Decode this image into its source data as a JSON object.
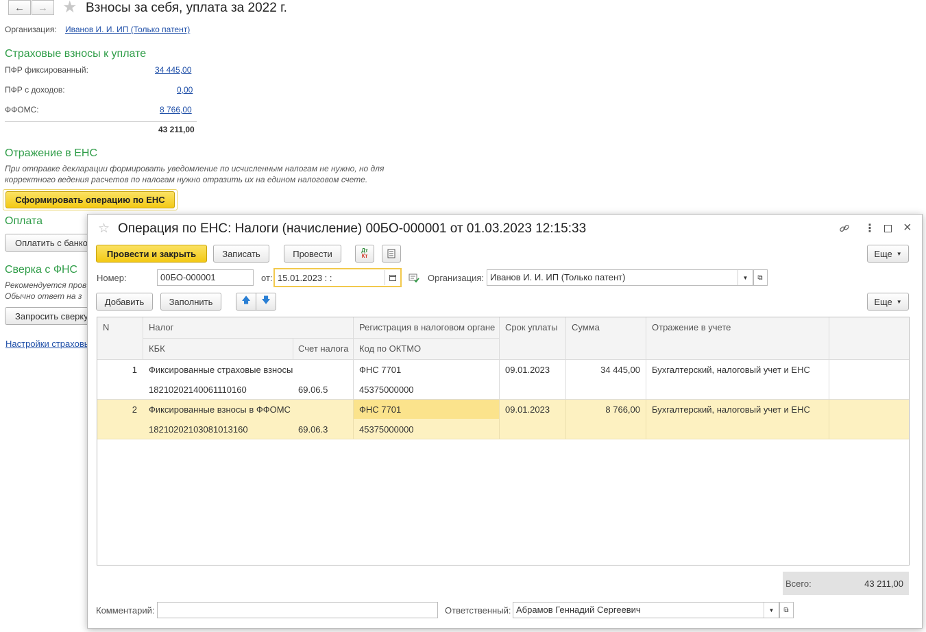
{
  "window": {
    "title": "Взносы за себя, уплата за 2022 г.",
    "org_label": "Организация:",
    "org_value": "Иванов И. И. ИП (Только патент)"
  },
  "contributions": {
    "heading": "Страховые взносы к уплате",
    "rows": [
      {
        "label": "ПФР фиксированный:",
        "value": "34 445,00"
      },
      {
        "label": "ПФР с доходов:",
        "value": "0,00"
      },
      {
        "label": "ФФОМС:",
        "value": "8 766,00"
      }
    ],
    "total": "43 211,00"
  },
  "ens": {
    "heading": "Отражение в ЕНС",
    "note_line1": "При отправке декларации формировать уведомление по исчисленным налогам не нужно, но для",
    "note_line2": "корректного ведения расчетов по налогам нужно отразить их на едином налоговом счете.",
    "button": "Сформировать операцию по ЕНС"
  },
  "payment": {
    "heading": "Оплата",
    "button": "Оплатить с банков"
  },
  "fns": {
    "heading": "Сверка с ФНС",
    "note_line1": "Рекомендуется пров",
    "note_line2": "Обычно ответ на з",
    "button": "Запросить сверку"
  },
  "settings_link": "Настройки страховы",
  "modal": {
    "title": "Операция по ЕНС: Налоги (начисление) 00БО-000001 от 01.03.2023 12:15:33",
    "buttons": {
      "post_close": "Провести и закрыть",
      "save": "Записать",
      "post": "Провести",
      "more": "Еще",
      "add": "Добавить",
      "fill": "Заполнить",
      "more2": "Еще"
    },
    "number_label": "Номер:",
    "number_value": "00БО-000001",
    "date_label": "от:",
    "date_value": "15.01.2023  :  :",
    "org_label": "Организация:",
    "org_value": "Иванов И. И. ИП (Только патент)",
    "table": {
      "headers": {
        "n": "N",
        "tax": "Налог",
        "kbk": "КБК",
        "account": "Счет налога",
        "registration": "Регистрация в налоговом органе",
        "oktmo": "Код по ОКТМО",
        "due": "Срок уплаты",
        "amount": "Сумма",
        "reflection": "Отражение в учете"
      },
      "rows": [
        {
          "n": "1",
          "tax": "Фиксированные страховые взносы",
          "kbk": "18210202140061110160",
          "account": "69.06.5",
          "registration": "ФНС 7701",
          "oktmo": "45375000000",
          "due": "09.01.2023",
          "amount": "34 445,00",
          "reflection": "Бухгалтерский, налоговый учет и ЕНС"
        },
        {
          "n": "2",
          "tax": "Фиксированные взносы в ФФОМС",
          "kbk": "18210202103081013160",
          "account": "69.06.3",
          "registration": "ФНС 7701",
          "oktmo": "45375000000",
          "due": "09.01.2023",
          "amount": "8 766,00",
          "reflection": "Бухгалтерский, налоговый учет и ЕНС"
        }
      ]
    },
    "total_label": "Всего:",
    "total_value": "43 211,00",
    "comment_label": "Комментарий:",
    "comment_value": "",
    "responsible_label": "Ответственный:",
    "responsible_value": "Абрамов Геннадий Сергеевич"
  },
  "colors": {
    "accent_green": "#2f9d48",
    "link_blue": "#1f4fa8",
    "button_yellow": "#f3c915",
    "row_selected": "#fdf1c1",
    "cell_selected": "#fbe38c"
  }
}
